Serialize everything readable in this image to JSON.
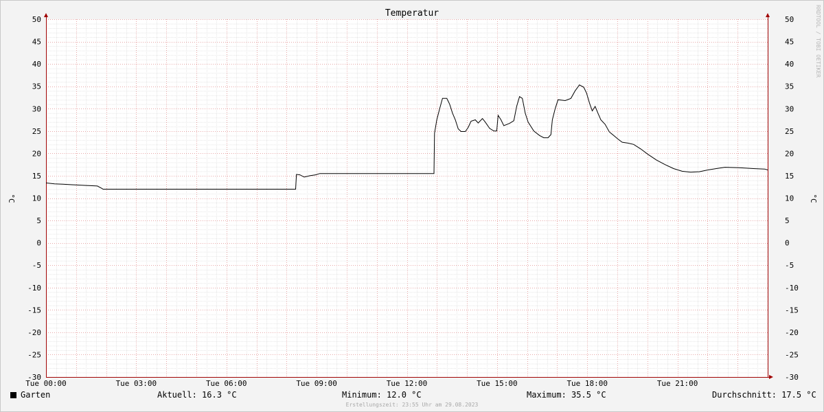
{
  "chart_data": {
    "type": "line",
    "title": "Temperatur",
    "ylabel": "°C",
    "watermark": "RRDTOOL / TOBI OETIKER",
    "ylim": [
      -30,
      50
    ],
    "yticks": [
      50,
      45,
      40,
      35,
      30,
      25,
      20,
      15,
      10,
      5,
      0,
      -5,
      -10,
      -15,
      -20,
      -25,
      -30
    ],
    "xlim": [
      0,
      24
    ],
    "xticks": [
      {
        "h": 0,
        "label": "Tue 00:00"
      },
      {
        "h": 3,
        "label": "Tue 03:00"
      },
      {
        "h": 6,
        "label": "Tue 06:00"
      },
      {
        "h": 9,
        "label": "Tue 09:00"
      },
      {
        "h": 12,
        "label": "Tue 12:00"
      },
      {
        "h": 15,
        "label": "Tue 15:00"
      },
      {
        "h": 18,
        "label": "Tue 18:00"
      },
      {
        "h": 21,
        "label": "Tue 21:00"
      }
    ],
    "series": [
      {
        "name": "Garten",
        "color": "#000000",
        "points": [
          [
            0.0,
            13.4
          ],
          [
            0.3,
            13.2
          ],
          [
            0.6,
            13.1
          ],
          [
            0.9,
            13.0
          ],
          [
            1.2,
            12.9
          ],
          [
            1.5,
            12.8
          ],
          [
            1.8,
            12.7
          ],
          [
            1.95,
            12.2
          ],
          [
            2.0,
            12.0
          ],
          [
            4.0,
            12.0
          ],
          [
            6.0,
            12.0
          ],
          [
            8.0,
            12.0
          ],
          [
            8.75,
            12.0
          ],
          [
            8.78,
            15.3
          ],
          [
            8.9,
            15.2
          ],
          [
            9.05,
            14.7
          ],
          [
            9.25,
            15.0
          ],
          [
            9.45,
            15.2
          ],
          [
            9.6,
            15.5
          ],
          [
            11.0,
            15.5
          ],
          [
            12.0,
            15.5
          ],
          [
            13.6,
            15.5
          ],
          [
            13.62,
            24.5
          ],
          [
            13.7,
            27.5
          ],
          [
            13.8,
            30.0
          ],
          [
            13.9,
            32.3
          ],
          [
            14.05,
            32.3
          ],
          [
            14.15,
            31.0
          ],
          [
            14.25,
            29.0
          ],
          [
            14.35,
            27.5
          ],
          [
            14.45,
            25.5
          ],
          [
            14.55,
            24.9
          ],
          [
            14.7,
            24.9
          ],
          [
            14.8,
            25.8
          ],
          [
            14.9,
            27.2
          ],
          [
            15.05,
            27.5
          ],
          [
            15.15,
            26.8
          ],
          [
            15.3,
            27.8
          ],
          [
            15.4,
            27.0
          ],
          [
            15.55,
            25.6
          ],
          [
            15.7,
            25.0
          ],
          [
            15.8,
            25.0
          ],
          [
            15.85,
            28.5
          ],
          [
            15.95,
            27.5
          ],
          [
            16.05,
            26.2
          ],
          [
            16.25,
            26.7
          ],
          [
            16.4,
            27.3
          ],
          [
            16.5,
            30.5
          ],
          [
            16.6,
            32.7
          ],
          [
            16.7,
            32.3
          ],
          [
            16.8,
            29.0
          ],
          [
            16.9,
            27.0
          ],
          [
            17.1,
            25.0
          ],
          [
            17.3,
            24.0
          ],
          [
            17.45,
            23.5
          ],
          [
            17.6,
            23.5
          ],
          [
            17.7,
            24.2
          ],
          [
            17.75,
            27.5
          ],
          [
            17.85,
            30.0
          ],
          [
            17.95,
            32.0
          ],
          [
            18.2,
            31.8
          ],
          [
            18.4,
            32.3
          ],
          [
            18.55,
            34.0
          ],
          [
            18.7,
            35.3
          ],
          [
            18.85,
            34.8
          ],
          [
            18.95,
            33.5
          ],
          [
            19.05,
            31.3
          ],
          [
            19.15,
            29.5
          ],
          [
            19.25,
            30.5
          ],
          [
            19.35,
            29.0
          ],
          [
            19.45,
            27.5
          ],
          [
            19.6,
            26.5
          ],
          [
            19.75,
            24.8
          ],
          [
            19.9,
            24.0
          ],
          [
            20.05,
            23.2
          ],
          [
            20.2,
            22.5
          ],
          [
            20.4,
            22.3
          ],
          [
            20.6,
            22.0
          ],
          [
            20.85,
            21.0
          ],
          [
            21.1,
            19.8
          ],
          [
            21.4,
            18.5
          ],
          [
            21.7,
            17.5
          ],
          [
            22.0,
            16.6
          ],
          [
            22.3,
            16.0
          ],
          [
            22.6,
            15.8
          ],
          [
            22.9,
            15.9
          ],
          [
            23.2,
            16.3
          ],
          [
            23.5,
            16.6
          ],
          [
            23.8,
            16.9
          ],
          [
            24.3,
            16.8
          ],
          [
            24.8,
            16.6
          ],
          [
            25.2,
            16.5
          ],
          [
            25.3,
            16.3
          ]
        ]
      }
    ]
  },
  "footer": {
    "legend_label": "Garten",
    "aktuell": "Aktuell: 16.3 °C",
    "minimum": "Minimum: 12.0 °C",
    "maximum": "Maximum: 35.5 °C",
    "durchschnitt": "Durchschnitt: 17.5 °C",
    "erstellungszeit": "Erstellungszeit: 23:55 Uhr am 29.08.2023"
  }
}
